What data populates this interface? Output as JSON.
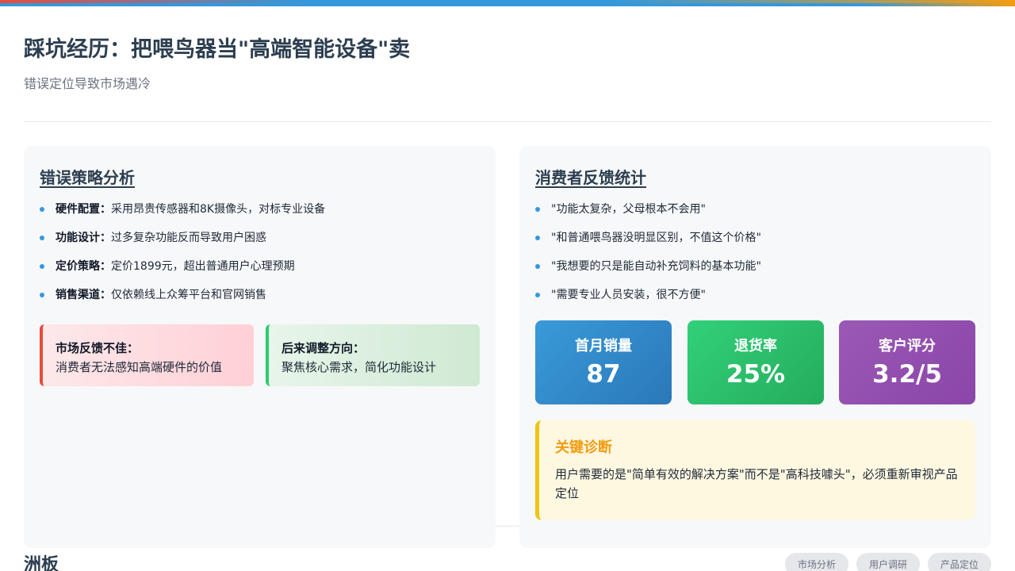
{
  "header": {
    "title": "踩坑经历：把喂鸟器当\"高端智能设备\"卖",
    "subtitle": "错误定位导致市场遇冷"
  },
  "strategy": {
    "title": "错误策略分析",
    "items": [
      {
        "key": "硬件配置：",
        "text": "采用昂贵传感器和8K摄像头，对标专业设备"
      },
      {
        "key": "功能设计：",
        "text": "过多复杂功能反而导致用户困惑"
      },
      {
        "key": "定价策略：",
        "text": "定价1899元，超出普通用户心理预期"
      },
      {
        "key": "销售渠道：",
        "text": "仅依赖线上众筹平台和官网销售"
      }
    ],
    "notes": [
      {
        "title": "市场反馈不佳：",
        "body": "消费者无法感知高端硬件的价值"
      },
      {
        "title": "后来调整方向：",
        "body": "聚焦核心需求，简化功能设计"
      }
    ]
  },
  "feedback": {
    "title": "消费者反馈统计",
    "quotes": [
      "\"功能太复杂，父母根本不会用\"",
      "\"和普通喂鸟器没明显区别，不值这个价格\"",
      "\"我想要的只是能自动补充饲料的基本功能\"",
      "\"需要专业人员安装，很不方便\""
    ],
    "stats": [
      {
        "label": "首月销量",
        "value": "87",
        "color": "#3498db"
      },
      {
        "label": "退货率",
        "value": "25%",
        "color": "#2ecc71"
      },
      {
        "label": "客户评分",
        "value": "3.2/5",
        "color": "#9b59b6"
      }
    ],
    "diagnosis": {
      "title": "关键诊断",
      "body": "用户需要的是\"简单有效的解决方案\"而不是\"高科技噱头\"，必须重新审视产品定位"
    }
  },
  "footer": {
    "label": "洲板",
    "tags": [
      "市场分析",
      "用户调研",
      "产品定位"
    ]
  }
}
